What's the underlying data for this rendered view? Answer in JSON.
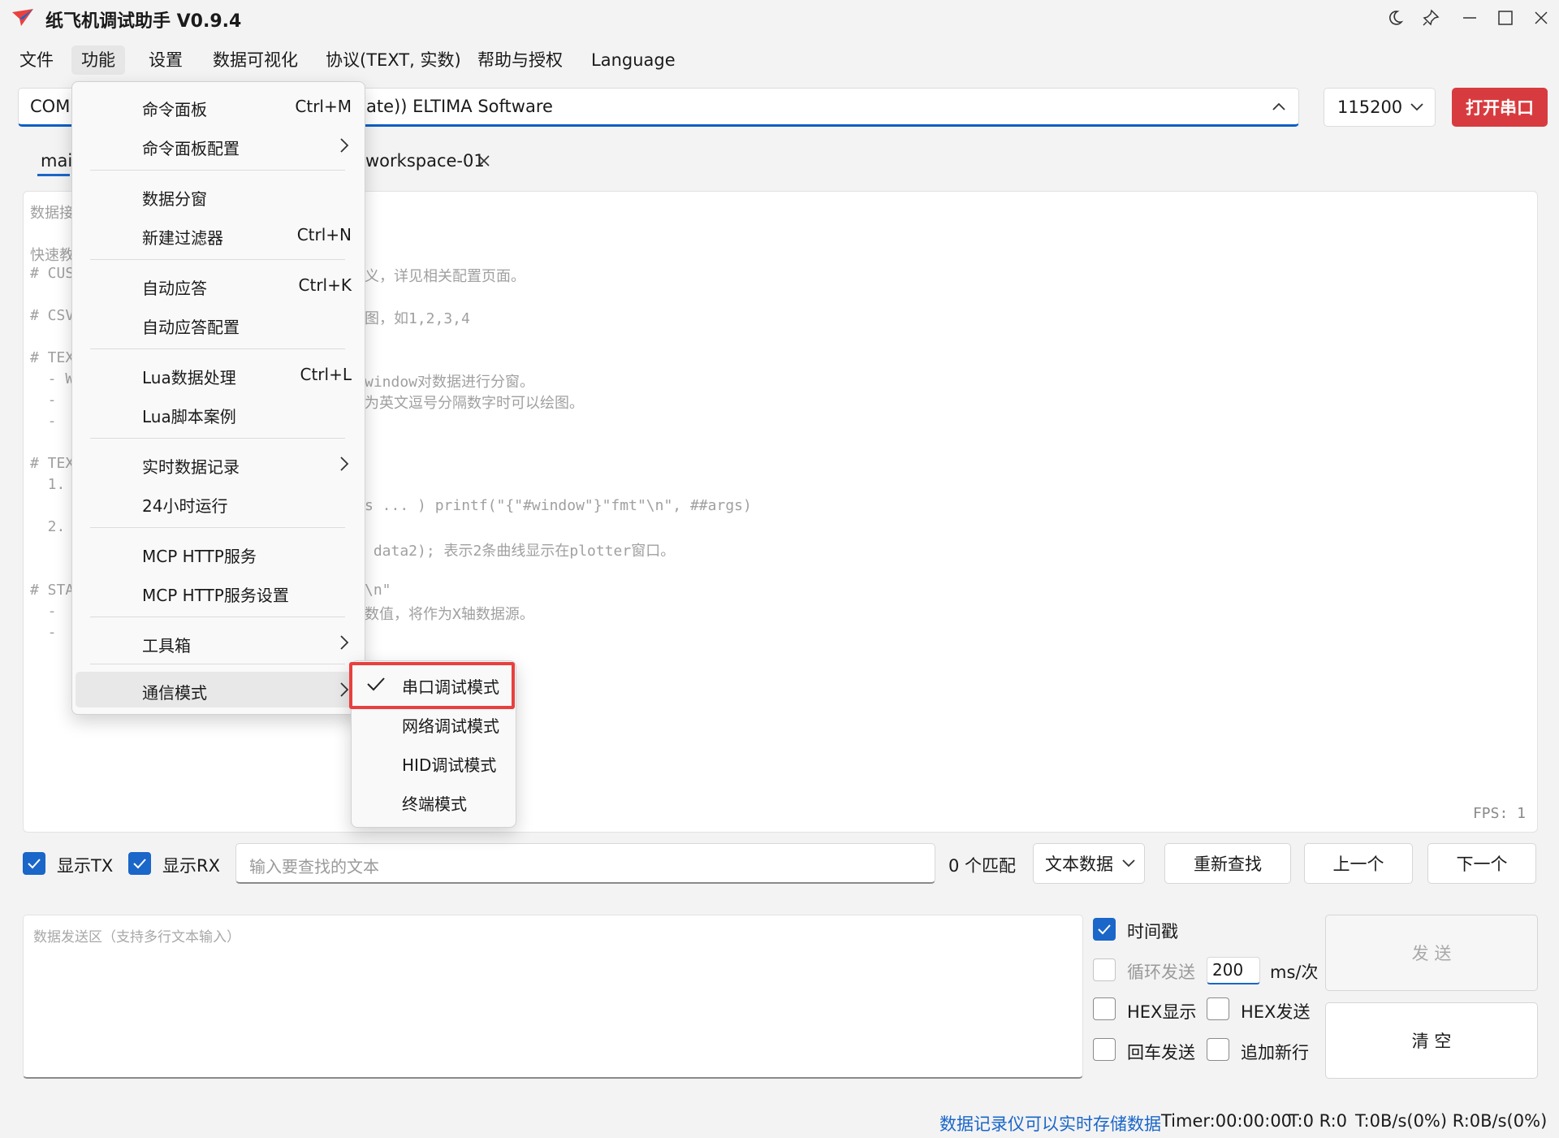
{
  "app": {
    "title": "纸飞机调试助手 V0.9.4"
  },
  "menubar": [
    "文件",
    "功能",
    "设置",
    "数据可视化",
    "协议(TEXT, 实数)",
    "帮助与授权",
    "Language"
  ],
  "port": {
    "prefix": "COM",
    "suffix": "ate)) ELTIMA Software",
    "baud": "115200",
    "open_label": "打开串口"
  },
  "tabs": {
    "first": "mai",
    "second": "workspace-01"
  },
  "recv": {
    "lines": [
      "数据接",
      "",
      "快速教",
      "# CUS",
      "",
      "# CSV",
      "",
      "# TEX",
      "  - W",
      "  - ",
      "  - ",
      "",
      "# TEX",
      "  1.",
      "    ",
      "  2.",
      "    ",
      "",
      "# STA",
      "  - ",
      "  - "
    ],
    "frags": [
      {
        "line": 3,
        "text": "义，详见相关配置页面。"
      },
      {
        "line": 5,
        "text": "图，如1,2,3,4"
      },
      {
        "line": 8,
        "text": "window对数据进行分窗。"
      },
      {
        "line": 9,
        "text": "为英文逗号分隔数字时可以绘图。"
      },
      {
        "line": 14,
        "text": "s ... ) printf(\"{\"#window\"}\"fmt\"\\n\", ##args)"
      },
      {
        "line": 16,
        "text": " data2); 表示2条曲线显示在plotter窗口。"
      },
      {
        "line": 18,
        "text": "\\n\""
      },
      {
        "line": 19,
        "text": "数值，将作为X轴数据源。"
      }
    ],
    "fps": "FPS: 1"
  },
  "search": {
    "show_tx": "显示TX",
    "show_rx": "显示RX",
    "placeholder": "输入要查找的文本",
    "match": "0 个匹配",
    "type": "文本数据",
    "refind": "重新查找",
    "prev": "上一个",
    "next": "下一个"
  },
  "send": {
    "placeholder": "数据发送区（支持多行文本输入）",
    "timestamp": "时间戳",
    "loop": "循环发送",
    "interval": "200",
    "unit": "ms/次",
    "hex_show": "HEX显示",
    "hex_send": "HEX发送",
    "enter_send": "回车发送",
    "append_nl": "追加新行",
    "send_btn": "发 送",
    "clear_btn": "清 空"
  },
  "status": {
    "link": "数据记录仪可以实时存储数据",
    "timer": "Timer:00:00:00",
    "tr": "T:0 R:0",
    "rate": "T:0B/s(0%) R:0B/s(0%)"
  },
  "func_menu": {
    "items": [
      {
        "label": "命令面板",
        "shortcut": "Ctrl+M"
      },
      {
        "label": "命令面板配置"
      },
      {
        "label": "数据分窗"
      },
      {
        "label": "新建过滤器",
        "shortcut": "Ctrl+N"
      },
      {
        "label": "自动应答",
        "shortcut": "Ctrl+K"
      },
      {
        "label": "自动应答配置"
      },
      {
        "label": "Lua数据处理",
        "shortcut": "Ctrl+L"
      },
      {
        "label": "Lua脚本案例"
      },
      {
        "label": "实时数据记录"
      },
      {
        "label": "24小时运行"
      },
      {
        "label": "MCP HTTP服务"
      },
      {
        "label": "MCP HTTP服务设置"
      },
      {
        "label": "工具箱"
      },
      {
        "label": "通信模式"
      }
    ]
  },
  "comm_menu": {
    "items": [
      "串口调试模式",
      "网络调试模式",
      "HID调试模式",
      "终端模式"
    ]
  },
  "colors": {
    "accent": "#1a66c9",
    "danger": "#d83b3f",
    "highlight": "#e8403f"
  }
}
